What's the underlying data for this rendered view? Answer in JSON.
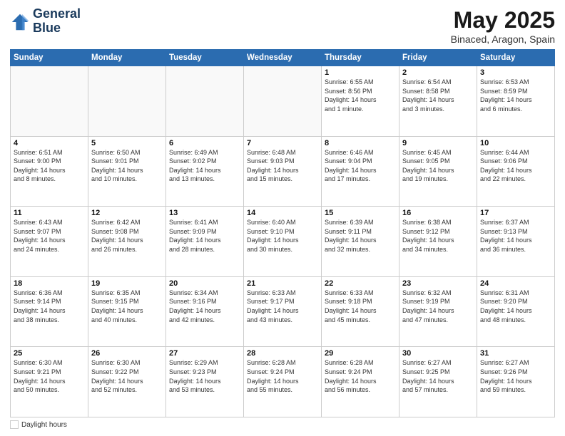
{
  "header": {
    "logo_line1": "General",
    "logo_line2": "Blue",
    "title": "May 2025",
    "location": "Binaced, Aragon, Spain"
  },
  "weekdays": [
    "Sunday",
    "Monday",
    "Tuesday",
    "Wednesday",
    "Thursday",
    "Friday",
    "Saturday"
  ],
  "weeks": [
    [
      {
        "day": "",
        "info": ""
      },
      {
        "day": "",
        "info": ""
      },
      {
        "day": "",
        "info": ""
      },
      {
        "day": "",
        "info": ""
      },
      {
        "day": "1",
        "info": "Sunrise: 6:55 AM\nSunset: 8:56 PM\nDaylight: 14 hours\nand 1 minute."
      },
      {
        "day": "2",
        "info": "Sunrise: 6:54 AM\nSunset: 8:58 PM\nDaylight: 14 hours\nand 3 minutes."
      },
      {
        "day": "3",
        "info": "Sunrise: 6:53 AM\nSunset: 8:59 PM\nDaylight: 14 hours\nand 6 minutes."
      }
    ],
    [
      {
        "day": "4",
        "info": "Sunrise: 6:51 AM\nSunset: 9:00 PM\nDaylight: 14 hours\nand 8 minutes."
      },
      {
        "day": "5",
        "info": "Sunrise: 6:50 AM\nSunset: 9:01 PM\nDaylight: 14 hours\nand 10 minutes."
      },
      {
        "day": "6",
        "info": "Sunrise: 6:49 AM\nSunset: 9:02 PM\nDaylight: 14 hours\nand 13 minutes."
      },
      {
        "day": "7",
        "info": "Sunrise: 6:48 AM\nSunset: 9:03 PM\nDaylight: 14 hours\nand 15 minutes."
      },
      {
        "day": "8",
        "info": "Sunrise: 6:46 AM\nSunset: 9:04 PM\nDaylight: 14 hours\nand 17 minutes."
      },
      {
        "day": "9",
        "info": "Sunrise: 6:45 AM\nSunset: 9:05 PM\nDaylight: 14 hours\nand 19 minutes."
      },
      {
        "day": "10",
        "info": "Sunrise: 6:44 AM\nSunset: 9:06 PM\nDaylight: 14 hours\nand 22 minutes."
      }
    ],
    [
      {
        "day": "11",
        "info": "Sunrise: 6:43 AM\nSunset: 9:07 PM\nDaylight: 14 hours\nand 24 minutes."
      },
      {
        "day": "12",
        "info": "Sunrise: 6:42 AM\nSunset: 9:08 PM\nDaylight: 14 hours\nand 26 minutes."
      },
      {
        "day": "13",
        "info": "Sunrise: 6:41 AM\nSunset: 9:09 PM\nDaylight: 14 hours\nand 28 minutes."
      },
      {
        "day": "14",
        "info": "Sunrise: 6:40 AM\nSunset: 9:10 PM\nDaylight: 14 hours\nand 30 minutes."
      },
      {
        "day": "15",
        "info": "Sunrise: 6:39 AM\nSunset: 9:11 PM\nDaylight: 14 hours\nand 32 minutes."
      },
      {
        "day": "16",
        "info": "Sunrise: 6:38 AM\nSunset: 9:12 PM\nDaylight: 14 hours\nand 34 minutes."
      },
      {
        "day": "17",
        "info": "Sunrise: 6:37 AM\nSunset: 9:13 PM\nDaylight: 14 hours\nand 36 minutes."
      }
    ],
    [
      {
        "day": "18",
        "info": "Sunrise: 6:36 AM\nSunset: 9:14 PM\nDaylight: 14 hours\nand 38 minutes."
      },
      {
        "day": "19",
        "info": "Sunrise: 6:35 AM\nSunset: 9:15 PM\nDaylight: 14 hours\nand 40 minutes."
      },
      {
        "day": "20",
        "info": "Sunrise: 6:34 AM\nSunset: 9:16 PM\nDaylight: 14 hours\nand 42 minutes."
      },
      {
        "day": "21",
        "info": "Sunrise: 6:33 AM\nSunset: 9:17 PM\nDaylight: 14 hours\nand 43 minutes."
      },
      {
        "day": "22",
        "info": "Sunrise: 6:33 AM\nSunset: 9:18 PM\nDaylight: 14 hours\nand 45 minutes."
      },
      {
        "day": "23",
        "info": "Sunrise: 6:32 AM\nSunset: 9:19 PM\nDaylight: 14 hours\nand 47 minutes."
      },
      {
        "day": "24",
        "info": "Sunrise: 6:31 AM\nSunset: 9:20 PM\nDaylight: 14 hours\nand 48 minutes."
      }
    ],
    [
      {
        "day": "25",
        "info": "Sunrise: 6:30 AM\nSunset: 9:21 PM\nDaylight: 14 hours\nand 50 minutes."
      },
      {
        "day": "26",
        "info": "Sunrise: 6:30 AM\nSunset: 9:22 PM\nDaylight: 14 hours\nand 52 minutes."
      },
      {
        "day": "27",
        "info": "Sunrise: 6:29 AM\nSunset: 9:23 PM\nDaylight: 14 hours\nand 53 minutes."
      },
      {
        "day": "28",
        "info": "Sunrise: 6:28 AM\nSunset: 9:24 PM\nDaylight: 14 hours\nand 55 minutes."
      },
      {
        "day": "29",
        "info": "Sunrise: 6:28 AM\nSunset: 9:24 PM\nDaylight: 14 hours\nand 56 minutes."
      },
      {
        "day": "30",
        "info": "Sunrise: 6:27 AM\nSunset: 9:25 PM\nDaylight: 14 hours\nand 57 minutes."
      },
      {
        "day": "31",
        "info": "Sunrise: 6:27 AM\nSunset: 9:26 PM\nDaylight: 14 hours\nand 59 minutes."
      }
    ]
  ],
  "footer": {
    "legend_label": "Daylight hours"
  }
}
